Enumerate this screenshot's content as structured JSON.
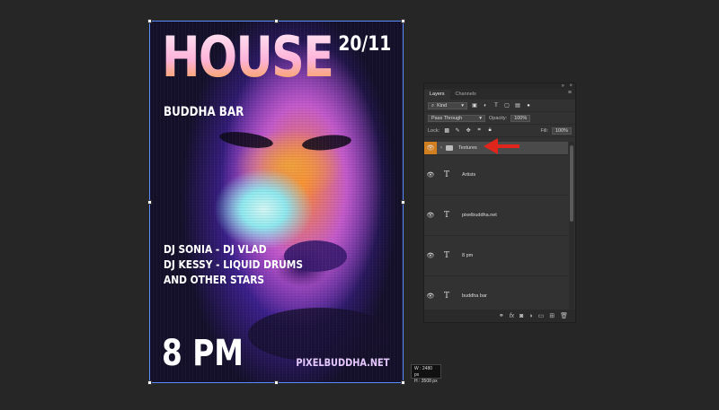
{
  "poster": {
    "title": "HOUSE",
    "date": "20/11",
    "venue": "BUDDHA BAR",
    "lineup": [
      "DJ SONIA - DJ VLAD",
      "DJ KESSY - LIQUID DRUMS",
      "AND OTHER STARS"
    ],
    "time": "8 PM",
    "website": "PIXELBUDDHA.NET"
  },
  "dimensions_tooltip": {
    "width_label": "W :",
    "width_value": "2480 px",
    "height_label": "H :",
    "height_value": "3508 px"
  },
  "layers_panel": {
    "tabs": [
      "Layers",
      "Channels"
    ],
    "active_tab": "Layers",
    "filter_kind": "Kind",
    "blend_mode": "Pass Through",
    "opacity_label": "Opacity:",
    "opacity_value": "100%",
    "lock_label": "Lock:",
    "fill_label": "Fill:",
    "fill_value": "100%",
    "layers": [
      {
        "name": "Textures",
        "type": "group",
        "selected": true
      },
      {
        "name": "Artists",
        "type": "text"
      },
      {
        "name": "pixelbuddha.net",
        "type": "text"
      },
      {
        "name": "8 pm",
        "type": "text"
      },
      {
        "name": "buddha bar",
        "type": "text"
      }
    ],
    "accent_color": "#d27f20"
  },
  "annotation": {
    "arrow_color": "#e0261c"
  }
}
